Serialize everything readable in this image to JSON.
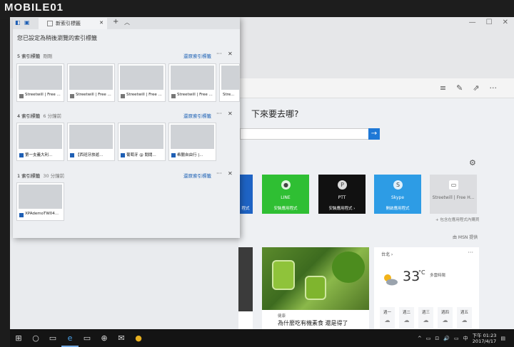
{
  "watermark": {
    "text": "MOBILE01"
  },
  "window": {
    "controls": [
      "—",
      "☐",
      "✕"
    ]
  },
  "browser_toolbar": {
    "icons": [
      "hub-icon",
      "note-icon",
      "share-icon",
      "more-icon"
    ]
  },
  "newtab_page": {
    "question": "下來要去哪?",
    "search_button": "→",
    "tiles": [
      {
        "name": "",
        "caption": "程式",
        "color": "#1e63c4"
      },
      {
        "name": "LINE",
        "caption": "安裝應用程式",
        "color": "#2fbf33"
      },
      {
        "name": "PTT",
        "caption": "安裝應用程式 ›",
        "color": "#111111"
      },
      {
        "name": "Skype",
        "caption": "開啟應用程式",
        "color": "#2d9ce5"
      },
      {
        "name": "Streetwill | Free H...",
        "caption": "",
        "color": "#dcdde0"
      }
    ],
    "add_app_text": "+ 包含在應用程式內購買",
    "msn_credit": "由 MSN 提供",
    "news_card": {
      "category": "健康",
      "title": "為什麼吃有機素食 還是得了"
    },
    "weather": {
      "city": "台北 ›",
      "temperature": "33",
      "unit": "°C",
      "description": "多雲時陽",
      "days": [
        "週一",
        "週二",
        "週三",
        "週四",
        "週五"
      ]
    }
  },
  "tab_overlay": {
    "tab_title": "新索引標籤",
    "heading": "您已設定為稍後瀏覽的索引標籤",
    "restore_label": "還原索引標籤",
    "more_label": "···",
    "close_label": "✕",
    "groups": [
      {
        "count_label": "5 索引標籤",
        "time": "剛剛",
        "tabs": [
          {
            "title": "Streetwill | Free ...",
            "thumb": "sh-city"
          },
          {
            "title": "Streetwill | Free ...",
            "thumb": "sh-street"
          },
          {
            "title": "Streetwill | Free ...",
            "thumb": "sh-doc"
          },
          {
            "title": "Streetwill | Free ...",
            "thumb": "sh-bridge"
          },
          {
            "title": "Stre...",
            "thumb": "sh-doc"
          }
        ]
      },
      {
        "count_label": "4 索引標籤",
        "time": "6 分鐘前",
        "tabs": [
          {
            "title": "第一支義大利...",
            "thumb": "sh-blog"
          },
          {
            "title": "【西班牙旅遊...",
            "thumb": "sh-shop"
          },
          {
            "title": "葡萄牙 @ 閱閱...",
            "thumb": "sh-sea"
          },
          {
            "title": "希臘自由行 |...",
            "thumb": "sh-sea2"
          }
        ]
      },
      {
        "count_label": "1 索引標籤",
        "time": "30 分鐘前",
        "tabs": [
          {
            "title": "XPAdemoTW04...",
            "thumb": "sh-dark"
          }
        ]
      }
    ]
  },
  "taskbar": {
    "items": [
      "⊞",
      "○",
      "▭",
      "e",
      "▭",
      "⊕",
      "✉",
      "●"
    ],
    "tray": [
      "^",
      "▭",
      "⊡",
      "🔊",
      "▭",
      "中"
    ],
    "time": "下午 01:23",
    "date": "2017/4/17"
  }
}
